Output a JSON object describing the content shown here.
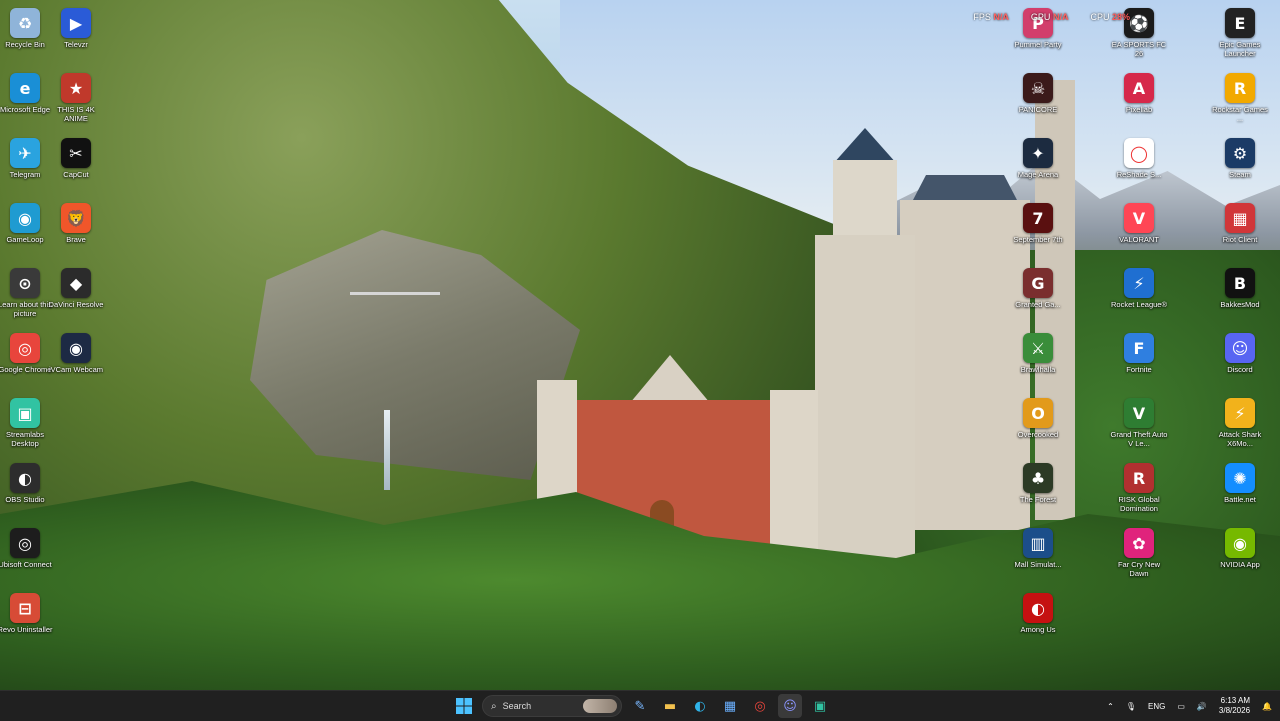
{
  "desktop": {
    "icons_left": [
      {
        "label": "Recycle Bin",
        "icon": "recycle-bin-icon",
        "color": "#8fb4d9",
        "glyph": "♻"
      },
      {
        "label": "Televzr",
        "icon": "televzr-icon",
        "color": "#2a5bd7",
        "glyph": "▶"
      },
      {
        "label": "Microsoft Edge",
        "icon": "edge-icon",
        "color": "#1a8fd6",
        "glyph": "e"
      },
      {
        "label": "THIS IS 4K ANIME",
        "icon": "anime-icon",
        "color": "#c0392b",
        "glyph": "★"
      },
      {
        "label": "Telegram",
        "icon": "telegram-icon",
        "color": "#2aa3df",
        "glyph": "✈"
      },
      {
        "label": "CapCut",
        "icon": "capcut-icon",
        "color": "#111111",
        "glyph": "✂"
      },
      {
        "label": "GameLoop",
        "icon": "gameloop-icon",
        "color": "#1f9bd1",
        "glyph": "◉"
      },
      {
        "label": "Brave",
        "icon": "brave-icon",
        "color": "#f0562a",
        "glyph": "🦁"
      },
      {
        "label": "Learn about this picture",
        "icon": "info-icon",
        "color": "#3a3a3a",
        "glyph": "⊙"
      },
      {
        "label": "DaVinci Resolve",
        "icon": "davinci-icon",
        "color": "#2b2b2b",
        "glyph": "◆"
      },
      {
        "label": "Google Chrome",
        "icon": "chrome-icon",
        "color": "#e8453c",
        "glyph": "◎"
      },
      {
        "label": "iVCam Webcam",
        "icon": "webcam-icon",
        "color": "#1d2a44",
        "glyph": "◉"
      },
      {
        "label": "Streamlabs Desktop",
        "icon": "streamlabs-icon",
        "color": "#31c3a2",
        "glyph": "▣"
      },
      {
        "label": "",
        "icon": "empty",
        "color": "",
        "glyph": ""
      },
      {
        "label": "OBS Studio",
        "icon": "obs-icon",
        "color": "#2d2d2d",
        "glyph": "◐"
      },
      {
        "label": "",
        "icon": "empty",
        "color": "",
        "glyph": ""
      },
      {
        "label": "Ubisoft Connect",
        "icon": "ubisoft-icon",
        "color": "#1d1d1d",
        "glyph": "◎"
      },
      {
        "label": "",
        "icon": "empty",
        "color": "",
        "glyph": ""
      },
      {
        "label": "Revo Uninstaller",
        "icon": "revo-icon",
        "color": "#d74b36",
        "glyph": "⊟"
      }
    ],
    "icons_right": [
      {
        "label": "Pummel Party",
        "icon": "pummel-party-icon",
        "color": "#d23e6b",
        "glyph": "P"
      },
      {
        "label": "EA SPORTS FC 26",
        "icon": "ea-sports-icon",
        "color": "#1b1b1b",
        "glyph": "⚽"
      },
      {
        "label": "Epic Games Launcher",
        "icon": "epic-games-icon",
        "color": "#222222",
        "glyph": "E"
      },
      {
        "label": "PANICORE",
        "icon": "panicore-icon",
        "color": "#3b1a1a",
        "glyph": "☠"
      },
      {
        "label": "Pixellab",
        "icon": "pixellab-icon",
        "color": "#d6284a",
        "glyph": "A"
      },
      {
        "label": "Rockstar Games ...",
        "icon": "rockstar-icon",
        "color": "#f2a900",
        "glyph": "R"
      },
      {
        "label": "Mage Arena",
        "icon": "mage-arena-icon",
        "color": "#1c2b40",
        "glyph": "✦"
      },
      {
        "label": "ReShade S...",
        "icon": "reshade-icon",
        "color": "#ffffff",
        "glyph": "◯"
      },
      {
        "label": "Steam",
        "icon": "steam-icon",
        "color": "#1b3b66",
        "glyph": "⚙"
      },
      {
        "label": "September 7th",
        "icon": "september-icon",
        "color": "#5a1010",
        "glyph": "7"
      },
      {
        "label": "VALORANT",
        "icon": "valorant-icon",
        "color": "#ff4655",
        "glyph": "V"
      },
      {
        "label": "Riot Client",
        "icon": "riot-icon",
        "color": "#d13639",
        "glyph": "▦"
      },
      {
        "label": "Granted Ga...",
        "icon": "granted-icon",
        "color": "#7a2e2e",
        "glyph": "G"
      },
      {
        "label": "Rocket League®",
        "icon": "rocket-league-icon",
        "color": "#1f6fd1",
        "glyph": "⚡"
      },
      {
        "label": "BakkesMod",
        "icon": "bakkesmod-icon",
        "color": "#111111",
        "glyph": "B"
      },
      {
        "label": "Brawlhalla",
        "icon": "brawlhalla-icon",
        "color": "#3a8d3a",
        "glyph": "⚔"
      },
      {
        "label": "Fortnite",
        "icon": "fortnite-icon",
        "color": "#2f7fe0",
        "glyph": "F"
      },
      {
        "label": "Discord",
        "icon": "discord-icon",
        "color": "#5865f2",
        "glyph": "☺"
      },
      {
        "label": "Overcooked",
        "icon": "overcooked-icon",
        "color": "#e29a1b",
        "glyph": "O"
      },
      {
        "label": "Grand Theft Auto V Le...",
        "icon": "gta-icon",
        "color": "#2e7d32",
        "glyph": "V"
      },
      {
        "label": "Attack Shark X6Mo...",
        "icon": "attack-shark-icon",
        "color": "#f2b21b",
        "glyph": "⚡"
      },
      {
        "label": "The Forest",
        "icon": "the-forest-icon",
        "color": "#2c3a25",
        "glyph": "♣"
      },
      {
        "label": "RISK Global Domination",
        "icon": "risk-icon",
        "color": "#b23030",
        "glyph": "R"
      },
      {
        "label": "Battle.net",
        "icon": "battlenet-icon",
        "color": "#148eff",
        "glyph": "✺"
      },
      {
        "label": "Mall Simulat...",
        "icon": "mall-sim-icon",
        "color": "#1c4e8a",
        "glyph": "▥"
      },
      {
        "label": "Far Cry New Dawn",
        "icon": "far-cry-icon",
        "color": "#e0237c",
        "glyph": "✿"
      },
      {
        "label": "NVIDIA App",
        "icon": "nvidia-icon",
        "color": "#76b900",
        "glyph": "◉"
      },
      {
        "label": "Among Us",
        "icon": "among-us-icon",
        "color": "#c51111",
        "glyph": "◐"
      }
    ]
  },
  "overlay": {
    "fps_label": "FPS",
    "fps_value": "N/A",
    "gpu_label": "GPU",
    "gpu_value": "N/A",
    "cpu_label": "CPU",
    "cpu_value": "28%"
  },
  "taskbar": {
    "search_placeholder": "Search",
    "lang": "ENG",
    "time": "6:13 AM",
    "date": "3/8/2026"
  }
}
